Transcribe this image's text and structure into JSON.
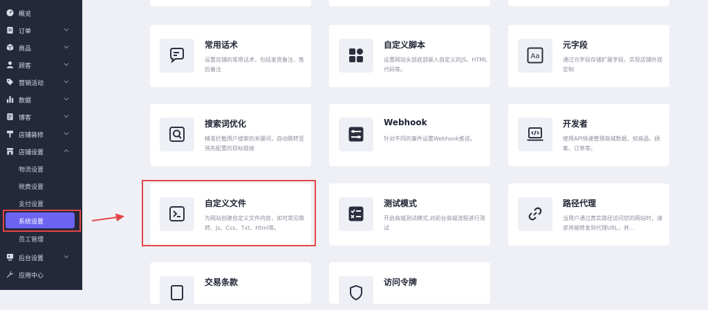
{
  "sidebar": {
    "items": [
      {
        "label": "概览",
        "icon": "speedometer-icon"
      },
      {
        "label": "订单",
        "icon": "clipboard-icon"
      },
      {
        "label": "商品",
        "icon": "box-icon"
      },
      {
        "label": "顾客",
        "icon": "user-icon"
      },
      {
        "label": "营销活动",
        "icon": "tag-icon"
      },
      {
        "label": "数据",
        "icon": "bar-chart-icon"
      },
      {
        "label": "博客",
        "icon": "document-icon"
      },
      {
        "label": "店铺装修",
        "icon": "brush-icon"
      },
      {
        "label": "店铺设置",
        "icon": "store-icon"
      },
      {
        "label": "后台设置",
        "icon": "monitor-icon"
      },
      {
        "label": "应用中心",
        "icon": "wrench-icon"
      }
    ],
    "sub_items": [
      "物流设置",
      "税费设置",
      "支付设置",
      "系统设置",
      "员工管理"
    ],
    "active_sub": "系统设置"
  },
  "cards": [
    {
      "title": "常用话术",
      "desc": "设置店铺的常用话术，包括发货备注、售后备注",
      "icon": "chat-icon"
    },
    {
      "title": "自定义脚本",
      "desc": "设置网站头部底部嵌入自定义的JS、HTML代码等。",
      "icon": "grid-icon"
    },
    {
      "title": "元字段",
      "desc": "通过元字段存储扩展字段，实现店铺外观定制",
      "icon": "font-icon"
    },
    {
      "title": "搜索词优化",
      "desc": "精准拦截用户搜索的关键词，自动跳转至预先配置的目标链接",
      "icon": "search-icon"
    },
    {
      "title": "Webhook",
      "desc": "针对不同的事件设置Webhook推送。",
      "icon": "sliders-icon"
    },
    {
      "title": "开发者",
      "desc": "使用API快速管理商城数据，如商品、顾客、订单等。",
      "icon": "code-laptop-icon"
    },
    {
      "title": "自定义文件",
      "desc": "为网站创建自定义文件内容，如可常见跳转、Js、Css、Txt、Html等。",
      "icon": "terminal-icon"
    },
    {
      "title": "测试模式",
      "desc": "开启商城测试模式,对前台商城流程进行测试",
      "icon": "checklist-icon"
    },
    {
      "title": "路径代理",
      "desc": "当用户通过真实路径访问您的网站时，请求将被转发到代理URL，并...",
      "icon": "link-icon"
    },
    {
      "title": "交易条款",
      "desc": "",
      "icon": "document-icon"
    },
    {
      "title": "访问令牌",
      "desc": "",
      "icon": "shield-icon"
    }
  ],
  "colors": {
    "sidebar_bg": "#24283b",
    "active": "#6c63f0",
    "highlight": "#e64545",
    "page_bg": "#eef0f5"
  }
}
